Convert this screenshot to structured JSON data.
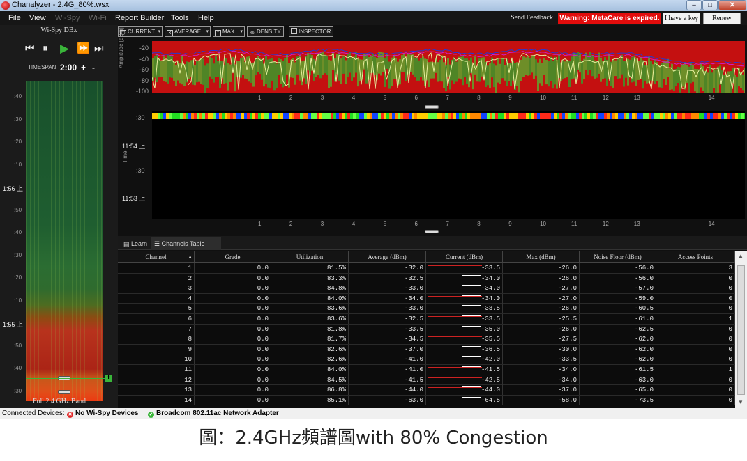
{
  "window": {
    "title": "Chanalyzer - 2.4G_80%.wsx",
    "minimize": "–",
    "maximize": "□",
    "close": "✕"
  },
  "menu": {
    "items": [
      "File",
      "View",
      "Wi-Spy",
      "Wi-Fi",
      "Report Builder",
      "Tools",
      "Help"
    ],
    "send_feedback": "Send Feedback",
    "warning": "Warning: MetaCare is expired.",
    "have_key": "I have a key",
    "renew": "Renew"
  },
  "left_panel": {
    "device": "Wi-Spy DBx",
    "timespan_label": "TIMESPAN",
    "timespan_value": "2:00",
    "plus": "+",
    "minus": "-",
    "band_label": "Full 2.4 GHz Band",
    "time_ticks": [
      ":40",
      ":30",
      ":20",
      ":10",
      "1:56 上",
      ":50",
      ":40",
      ":30",
      ":20",
      ":10",
      "1:55 上",
      ":50",
      ":40",
      ":30"
    ]
  },
  "toolbar": {
    "current": "CURRENT",
    "average": "AVERAGE",
    "max": "MAX",
    "density": "DENSITY",
    "inspector": "INSPECTOR"
  },
  "spectrum": {
    "axis_label": "Amplitude [dBm]",
    "y_ticks": [
      "-20",
      "-40",
      "-60",
      "-80",
      "-100"
    ],
    "channels": [
      "1",
      "2",
      "3",
      "4",
      "5",
      "6",
      "7",
      "8",
      "9",
      "10",
      "11",
      "12",
      "13",
      "14"
    ]
  },
  "waterfall": {
    "axis_label": "Time",
    "y_ticks": [
      ":30",
      "11:54 上",
      ":30",
      "11:53 上"
    ]
  },
  "tabs": {
    "learn": "Learn",
    "channels_table": "Channels Table"
  },
  "table": {
    "headers": [
      "Channel",
      "Grade",
      "Utilization",
      "Average (dBm)",
      "Current (dBm)",
      "Max (dBm)",
      "Noise Floor (dBm)",
      "Access Points"
    ],
    "rows": [
      {
        "channel": "1",
        "grade": "0.0",
        "util": "81.5%",
        "avg": "-32.0",
        "cur": "-33.5",
        "max": "-26.0",
        "noise": "-56.0",
        "ap": "3"
      },
      {
        "channel": "2",
        "grade": "0.0",
        "util": "83.3%",
        "avg": "-32.5",
        "cur": "-34.0",
        "max": "-26.0",
        "noise": "-56.0",
        "ap": "0"
      },
      {
        "channel": "3",
        "grade": "0.0",
        "util": "84.8%",
        "avg": "-33.0",
        "cur": "-34.0",
        "max": "-27.0",
        "noise": "-57.0",
        "ap": "0"
      },
      {
        "channel": "4",
        "grade": "0.0",
        "util": "84.0%",
        "avg": "-34.0",
        "cur": "-34.0",
        "max": "-27.0",
        "noise": "-59.0",
        "ap": "0"
      },
      {
        "channel": "5",
        "grade": "0.0",
        "util": "83.6%",
        "avg": "-33.0",
        "cur": "-33.5",
        "max": "-26.0",
        "noise": "-60.5",
        "ap": "0"
      },
      {
        "channel": "6",
        "grade": "0.0",
        "util": "83.6%",
        "avg": "-32.5",
        "cur": "-33.5",
        "max": "-25.5",
        "noise": "-61.0",
        "ap": "1"
      },
      {
        "channel": "7",
        "grade": "0.0",
        "util": "81.8%",
        "avg": "-33.5",
        "cur": "-35.0",
        "max": "-26.0",
        "noise": "-62.5",
        "ap": "0"
      },
      {
        "channel": "8",
        "grade": "0.0",
        "util": "81.7%",
        "avg": "-34.5",
        "cur": "-35.5",
        "max": "-27.5",
        "noise": "-62.0",
        "ap": "0"
      },
      {
        "channel": "9",
        "grade": "0.0",
        "util": "82.6%",
        "avg": "-37.0",
        "cur": "-36.5",
        "max": "-30.0",
        "noise": "-62.0",
        "ap": "0"
      },
      {
        "channel": "10",
        "grade": "0.0",
        "util": "82.6%",
        "avg": "-41.0",
        "cur": "-42.0",
        "max": "-33.5",
        "noise": "-62.0",
        "ap": "0"
      },
      {
        "channel": "11",
        "grade": "0.0",
        "util": "84.0%",
        "avg": "-41.0",
        "cur": "-41.5",
        "max": "-34.0",
        "noise": "-61.5",
        "ap": "1"
      },
      {
        "channel": "12",
        "grade": "0.0",
        "util": "84.5%",
        "avg": "-41.5",
        "cur": "-42.5",
        "max": "-34.0",
        "noise": "-63.0",
        "ap": "0"
      },
      {
        "channel": "13",
        "grade": "0.0",
        "util": "86.8%",
        "avg": "-44.0",
        "cur": "-44.0",
        "max": "-37.0",
        "noise": "-65.0",
        "ap": "0"
      },
      {
        "channel": "14",
        "grade": "0.0",
        "util": "85.1%",
        "avg": "-63.0",
        "cur": "-64.5",
        "max": "-58.0",
        "noise": "-73.5",
        "ap": "0"
      }
    ]
  },
  "statusbar": {
    "label": "Connected Devices:",
    "no_device": "No Wi-Spy Devices",
    "adapter": "Broadcom 802.11ac Network Adapter"
  },
  "caption": "圖：2.4GHz頻譜圖with 80% Congestion",
  "colors": {
    "warning_bg": "#e20c0c",
    "play_green": "#3ab53a",
    "trace_red": "#c41010"
  }
}
